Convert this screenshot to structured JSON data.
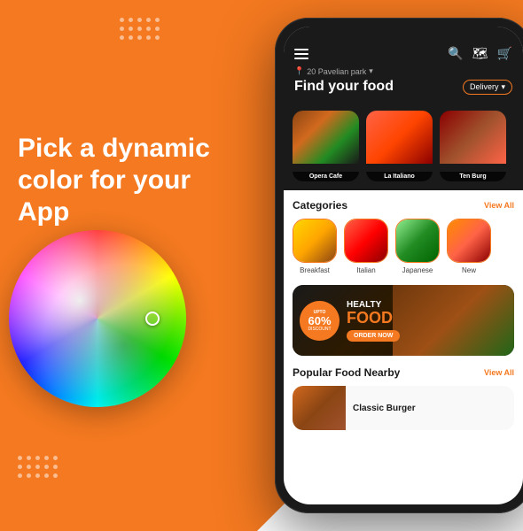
{
  "page": {
    "bg_color": "#F47920",
    "headline_line1": "Pick a dynamic",
    "headline_line2": "color for your App"
  },
  "phone": {
    "location": "20 Pavelian park",
    "find_food": "Find your food",
    "delivery_label": "Delivery",
    "featured_restaurants": [
      {
        "name": "Opera Cafe",
        "color": "food-img-1"
      },
      {
        "name": "La Italiano",
        "color": "food-img-2"
      },
      {
        "name": "Ten Burg",
        "color": "food-img-3"
      }
    ],
    "categories_title": "Categories",
    "view_all_label": "View All",
    "categories": [
      {
        "name": "Breakfast",
        "color": "cat-breakfast"
      },
      {
        "name": "Italian",
        "color": "cat-italian"
      },
      {
        "name": "Japanese",
        "color": "cat-japanese"
      },
      {
        "name": "New",
        "color": "cat-new"
      }
    ],
    "banner": {
      "upto_label": "UPTO",
      "discount": "60%",
      "discount_sub": "DISCOUNT",
      "healty_label": "HEALTY",
      "food_label": "FOOD",
      "order_btn": "ORDER NOW"
    },
    "popular_title": "Popular Food Nearby",
    "popular_view_all": "View All",
    "popular_items": [
      {
        "name": "Classic Burger"
      }
    ]
  },
  "dots": {
    "top_count": 15,
    "bottom_count": 15
  }
}
